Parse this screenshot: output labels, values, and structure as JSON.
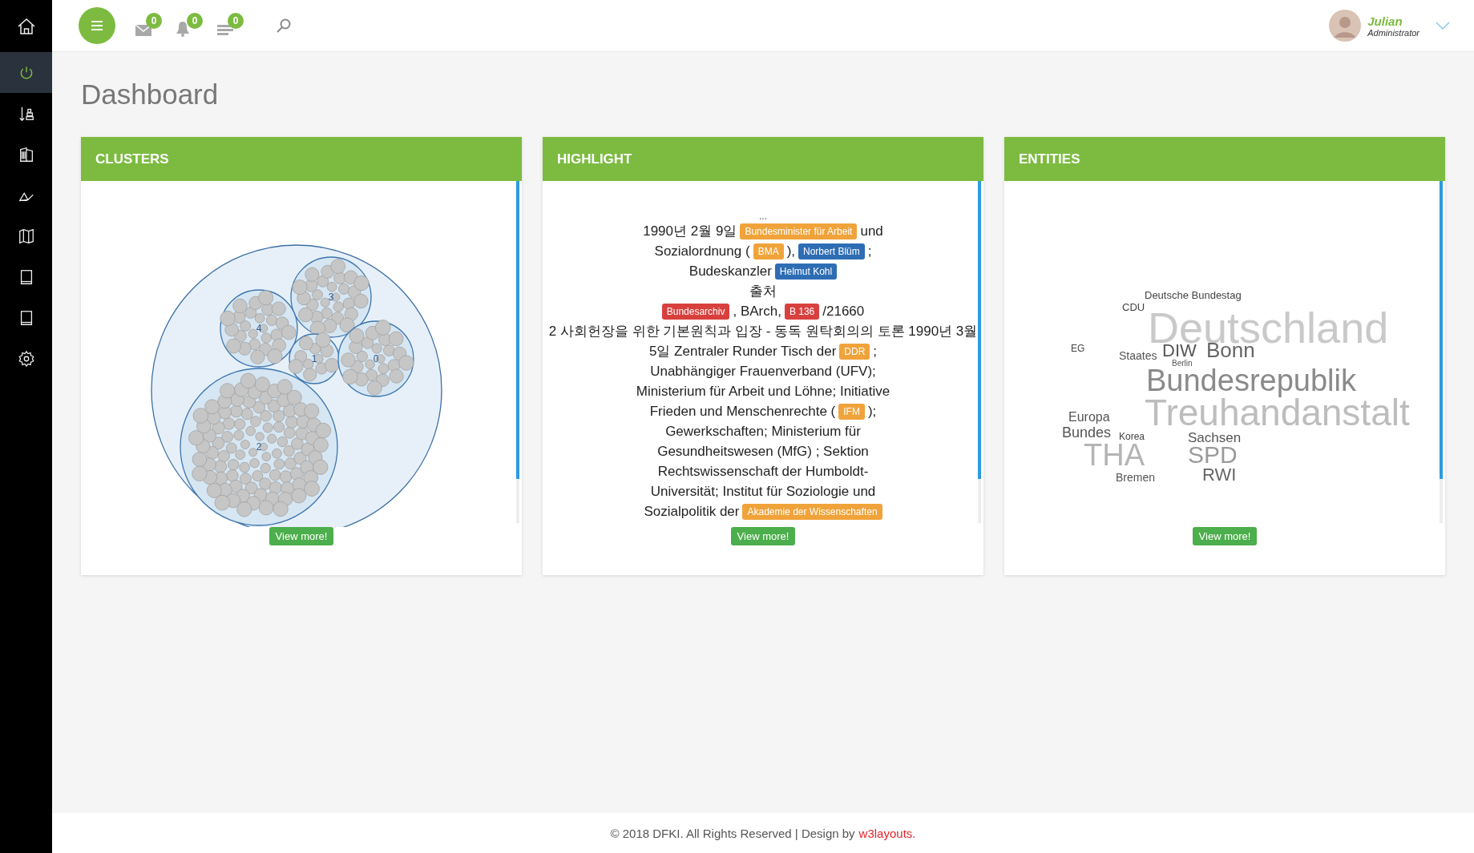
{
  "sidebar": {
    "items": [
      {
        "selected": false
      },
      {
        "selected": true
      },
      {
        "selected": false
      },
      {
        "selected": false
      },
      {
        "selected": false
      },
      {
        "selected": false
      },
      {
        "selected": false
      },
      {
        "selected": false
      },
      {
        "selected": false
      }
    ]
  },
  "topbar": {
    "badges": [
      {
        "count": "0"
      },
      {
        "count": "0"
      },
      {
        "count": "0"
      }
    ],
    "user": {
      "name": "Julian",
      "role": "Administrator"
    }
  },
  "page": {
    "title": "Dashboard"
  },
  "cards": [
    {
      "kind": "clusters",
      "title": "CLUSTERS",
      "cluster_labels": [
        "3",
        "4",
        "1",
        "0",
        "2"
      ],
      "button": "View more!"
    },
    {
      "kind": "highlight",
      "title": "HIGHLIGHT",
      "lead": "...",
      "lines": [
        [
          {
            "kind": "text",
            "text": "1990년 2월 9일"
          },
          {
            "kind": "tag",
            "text": "Bundesminister für Arbeit",
            "color": "#f0a33a"
          },
          {
            "kind": "text",
            "text": "und"
          }
        ],
        [
          {
            "kind": "text",
            "text": "Sozialordnung ("
          },
          {
            "kind": "tag",
            "text": "BMA",
            "color": "#f0a33a"
          },
          {
            "kind": "text",
            "text": "),"
          },
          {
            "kind": "tag",
            "text": "Norbert Blüm",
            "color": "#2e6db4"
          },
          {
            "kind": "text",
            "text": ";"
          }
        ],
        [
          {
            "kind": "text",
            "text": "Budeskanzler"
          },
          {
            "kind": "tag",
            "text": "Helmut Kohl",
            "color": "#2e6db4"
          }
        ],
        [
          {
            "kind": "text",
            "text": "출처"
          }
        ],
        [
          {
            "kind": "tag",
            "text": "Bundesarchiv",
            "color": "#d8403e"
          },
          {
            "kind": "text",
            "text": ", BArch,"
          },
          {
            "kind": "tag",
            "text": "B 136",
            "color": "#d8403e"
          },
          {
            "kind": "text",
            "text": "/21660"
          }
        ],
        [
          {
            "kind": "text",
            "text": "2 사회헌장을 위한 기본원칙과 입장 - 동독 원탁회의의 토론 1990년 3월"
          }
        ],
        [
          {
            "kind": "text",
            "text": "5일 Zentraler Runder Tisch der"
          },
          {
            "kind": "tag",
            "text": "DDR",
            "color": "#f0a33a"
          },
          {
            "kind": "text",
            "text": ";"
          }
        ],
        [
          {
            "kind": "text",
            "text": "Unabhängiger Frauenverband (UFV);"
          }
        ],
        [
          {
            "kind": "text",
            "text": "Ministerium für Arbeit und Löhne; Initiative"
          }
        ],
        [
          {
            "kind": "text",
            "text": "Frieden und Menschenrechte ("
          },
          {
            "kind": "tag",
            "text": "IFM",
            "color": "#f0a33a"
          },
          {
            "kind": "text",
            "text": ");"
          }
        ],
        [
          {
            "kind": "text",
            "text": "Gewerkschaften; Ministerium für"
          }
        ],
        [
          {
            "kind": "text",
            "text": "Gesundheitswesen (MfG) ; Sektion"
          }
        ],
        [
          {
            "kind": "text",
            "text": "Rechtswissenschaft der Humboldt-"
          }
        ],
        [
          {
            "kind": "text",
            "text": "Universität; Institut für Soziologie und"
          }
        ],
        [
          {
            "kind": "text",
            "text": "Sozialpolitik der"
          },
          {
            "kind": "tag",
            "text": "Akademie der Wissenschaften",
            "color": "#f0a33a"
          }
        ]
      ],
      "button": "View more!"
    },
    {
      "kind": "entities",
      "title": "ENTITIES",
      "words": [
        "Deutsche Bundestag",
        "CDU",
        "Deutschland",
        "EG",
        "Staates",
        "DIW",
        "Bonn",
        "Berlin",
        "Bundesrepublik",
        "Europa",
        "Bundes",
        "Treuhandanstalt",
        "Korea",
        "THA",
        "Sachsen",
        "SPD",
        "RWI",
        "Bremen"
      ],
      "button": "View more!"
    }
  ],
  "footer": {
    "text": "© 2018 DFKI. All Rights Reserved | Design by",
    "link": "w3layouts."
  }
}
